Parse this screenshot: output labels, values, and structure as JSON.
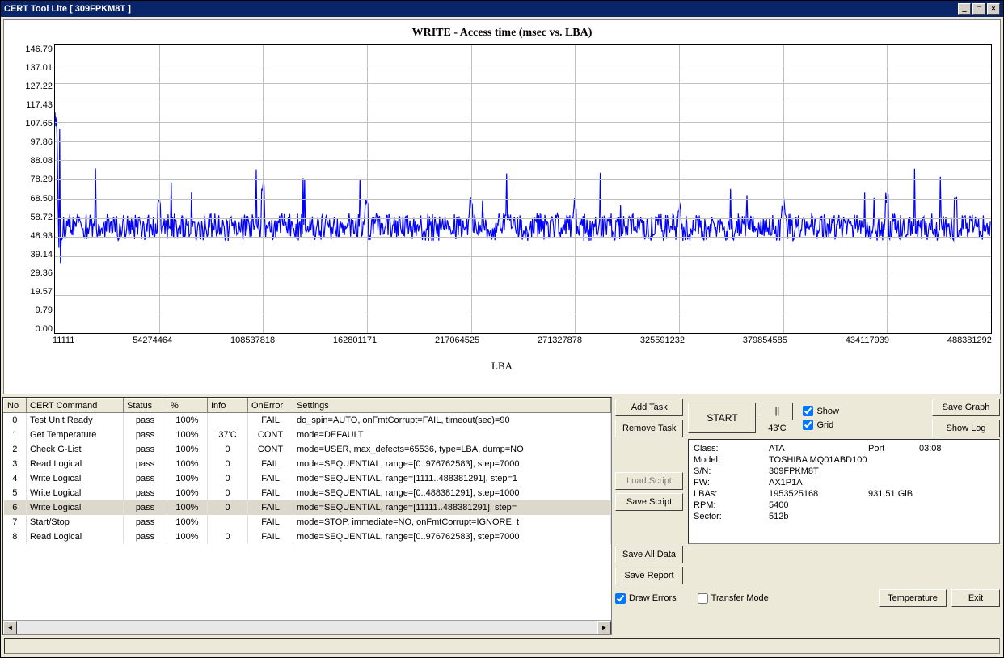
{
  "window": {
    "title": "CERT Tool Lite [ 309FPKM8T ]"
  },
  "chart": {
    "title": "WRITE - Access time (msec vs. LBA)",
    "xlabel": "LBA",
    "yticks": [
      "146.79",
      "137.01",
      "127.22",
      "117.43",
      "107.65",
      "97.86",
      "88.08",
      "78.29",
      "68.50",
      "58.72",
      "48.93",
      "39.14",
      "29.36",
      "19.57",
      "9.79",
      "0.00"
    ],
    "xticks": [
      "11111",
      "54274464",
      "108537818",
      "162801171",
      "217064525",
      "271327878",
      "325591232",
      "379854585",
      "434117939",
      "488381292"
    ]
  },
  "chart_data": {
    "type": "scatter",
    "title": "WRITE - Access time (msec vs. LBA)",
    "xlabel": "LBA",
    "ylabel": "Access time (msec)",
    "xlim": [
      11111,
      488381292
    ],
    "ylim": [
      0,
      146.79
    ],
    "note": "Dense per-LBA latency samples; values mostly clustered near ~54 msec with noise band roughly 48–62 msec and occasional spikes to ~70–115 msec; early startup spikes near LBA≈11111 up to ~115 msec.",
    "baseline_msec": 54,
    "noise_band_msec": [
      48,
      62
    ],
    "spike_examples": [
      {
        "lba": 11111,
        "msec": 115
      },
      {
        "lba": 120000,
        "msec": 73
      },
      {
        "lba": 54274464,
        "msec": 68
      },
      {
        "lba": 108537818,
        "msec": 77
      },
      {
        "lba": 162801171,
        "msec": 69
      },
      {
        "lba": 217064525,
        "msec": 70
      },
      {
        "lba": 271327878,
        "msec": 69
      },
      {
        "lba": 325591232,
        "msec": 67
      },
      {
        "lba": 379854585,
        "msec": 66
      },
      {
        "lba": 434117939,
        "msec": 72
      },
      {
        "lba": 470000000,
        "msec": 74
      }
    ]
  },
  "table": {
    "headers": [
      "No",
      "CERT Command",
      "Status",
      "%",
      "Info",
      "OnError",
      "Settings"
    ],
    "rows": [
      {
        "no": "0",
        "cmd": "Test Unit Ready",
        "status": "pass",
        "pct": "100%",
        "info": "",
        "onerr": "FAIL",
        "settings": "do_spin=AUTO, onFmtCorrupt=FAIL, timeout(sec)=90"
      },
      {
        "no": "1",
        "cmd": "Get Temperature",
        "status": "pass",
        "pct": "100%",
        "info": "37'C",
        "onerr": "CONT",
        "settings": "mode=DEFAULT"
      },
      {
        "no": "2",
        "cmd": "Check G-List",
        "status": "pass",
        "pct": "100%",
        "info": "0",
        "onerr": "CONT",
        "settings": "mode=USER, max_defects=65536, type=LBA, dump=NO"
      },
      {
        "no": "3",
        "cmd": "Read Logical",
        "status": "pass",
        "pct": "100%",
        "info": "0",
        "onerr": "FAIL",
        "settings": "mode=SEQUENTIAL, range=[0..976762583], step=7000"
      },
      {
        "no": "4",
        "cmd": "Write Logical",
        "status": "pass",
        "pct": "100%",
        "info": "0",
        "onerr": "FAIL",
        "settings": "mode=SEQUENTIAL, range=[1111..488381291], step=1"
      },
      {
        "no": "5",
        "cmd": "Write Logical",
        "status": "pass",
        "pct": "100%",
        "info": "0",
        "onerr": "FAIL",
        "settings": "mode=SEQUENTIAL, range=[0..488381291], step=1000"
      },
      {
        "no": "6",
        "cmd": "Write Logical",
        "status": "pass",
        "pct": "100%",
        "info": "0",
        "onerr": "FAIL",
        "settings": "mode=SEQUENTIAL, range=[11111..488381291], step="
      },
      {
        "no": "7",
        "cmd": "Start/Stop",
        "status": "pass",
        "pct": "100%",
        "info": "",
        "onerr": "FAIL",
        "settings": "mode=STOP, immediate=NO, onFmtCorrupt=IGNORE, t"
      },
      {
        "no": "8",
        "cmd": "Read Logical",
        "status": "pass",
        "pct": "100%",
        "info": "0",
        "onerr": "FAIL",
        "settings": "mode=SEQUENTIAL, range=[0..976762583], step=7000"
      }
    ],
    "selected_index": 6
  },
  "controls": {
    "add_task": "Add Task",
    "remove_task": "Remove Task",
    "start": "START",
    "pause": "||",
    "temp_now": "43'C",
    "load_script": "Load Script",
    "save_script": "Save Script",
    "save_all": "Save All Data",
    "save_report": "Save Report",
    "save_graph": "Save Graph",
    "show_log": "Show Log",
    "temperature": "Temperature",
    "exit": "Exit",
    "cb_show": "Show",
    "cb_grid": "Grid",
    "cb_draw_errors": "Draw Errors",
    "cb_transfer": "Transfer Mode"
  },
  "drive": {
    "class_lbl": "Class:",
    "class": "ATA",
    "port_lbl": "Port",
    "port": "03:08",
    "model_lbl": "Model:",
    "model": "TOSHIBA MQ01ABD100",
    "sn_lbl": "S/N:",
    "sn": "309FPKM8T",
    "fw_lbl": "FW:",
    "fw": "AX1P1A",
    "lbas_lbl": "LBAs:",
    "lbas": "1953525168",
    "size": "931.51 GiB",
    "rpm_lbl": "RPM:",
    "rpm": "5400",
    "sector_lbl": "Sector:",
    "sector": "512b"
  }
}
